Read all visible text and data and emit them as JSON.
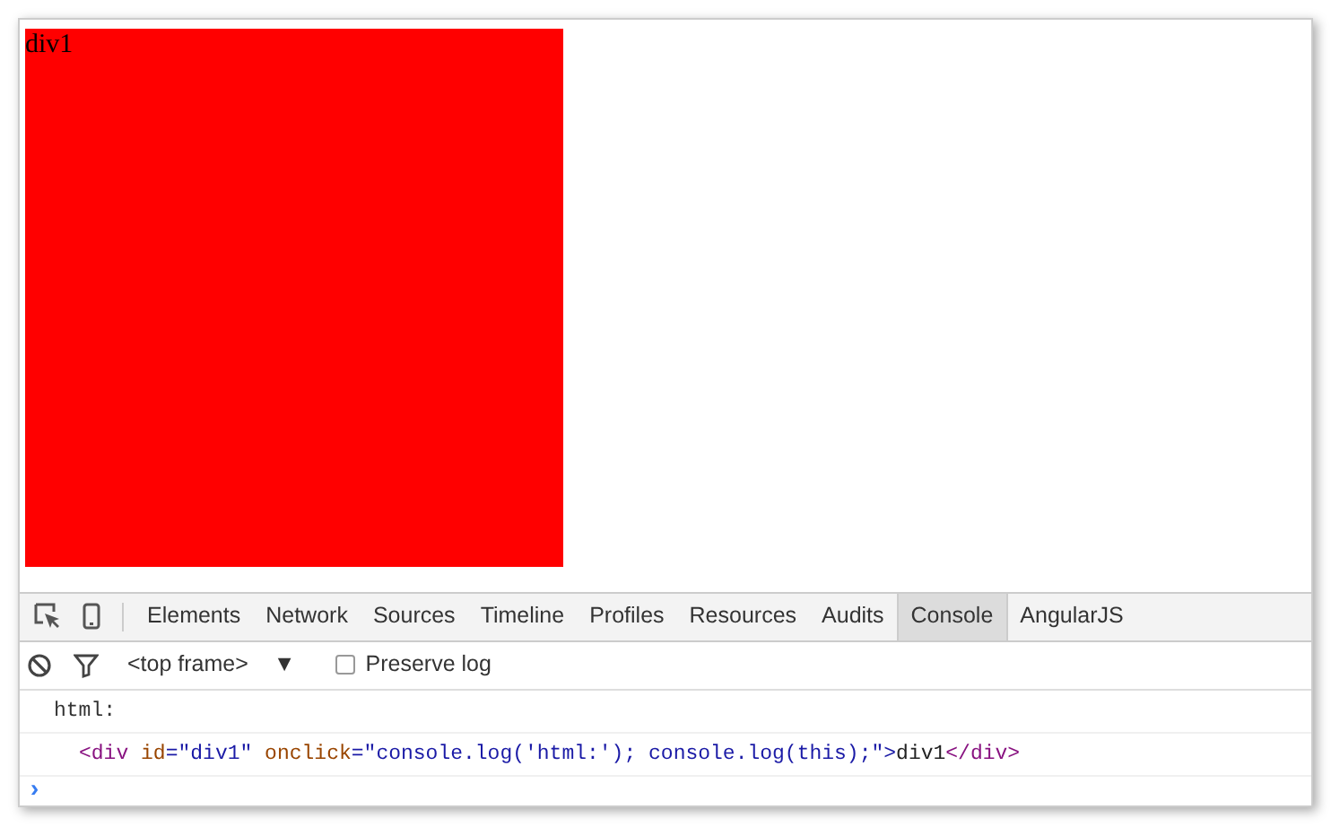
{
  "page": {
    "box_text": "div1"
  },
  "devtools": {
    "tabs": [
      {
        "label": "Elements",
        "selected": false
      },
      {
        "label": "Network",
        "selected": false
      },
      {
        "label": "Sources",
        "selected": false
      },
      {
        "label": "Timeline",
        "selected": false
      },
      {
        "label": "Profiles",
        "selected": false
      },
      {
        "label": "Resources",
        "selected": false
      },
      {
        "label": "Audits",
        "selected": false
      },
      {
        "label": "Console",
        "selected": true
      },
      {
        "label": "AngularJS",
        "selected": false
      }
    ],
    "toolbar": {
      "frame": "<top frame>",
      "dropdown": "▼",
      "preserve_log": {
        "label": "Preserve log",
        "checked": false
      }
    },
    "console": {
      "lines": [
        {
          "kind": "text",
          "text": "html:"
        },
        {
          "kind": "element",
          "tokens": [
            {
              "kind": "tag",
              "text": "<div"
            },
            {
              "kind": "attr-name",
              "text": " id"
            },
            {
              "kind": "punct",
              "text": "=\""
            },
            {
              "kind": "attr-value",
              "text": "div1"
            },
            {
              "kind": "punct",
              "text": "\""
            },
            {
              "kind": "attr-name",
              "text": " onclick"
            },
            {
              "kind": "punct",
              "text": "=\""
            },
            {
              "kind": "attr-value",
              "text": "console.log('html:'); console.log(this);"
            },
            {
              "kind": "punct",
              "text": "\">"
            },
            {
              "kind": "plain",
              "text": "div1"
            },
            {
              "kind": "tag",
              "text": "</div>"
            }
          ]
        }
      ],
      "prompt": "›"
    }
  }
}
